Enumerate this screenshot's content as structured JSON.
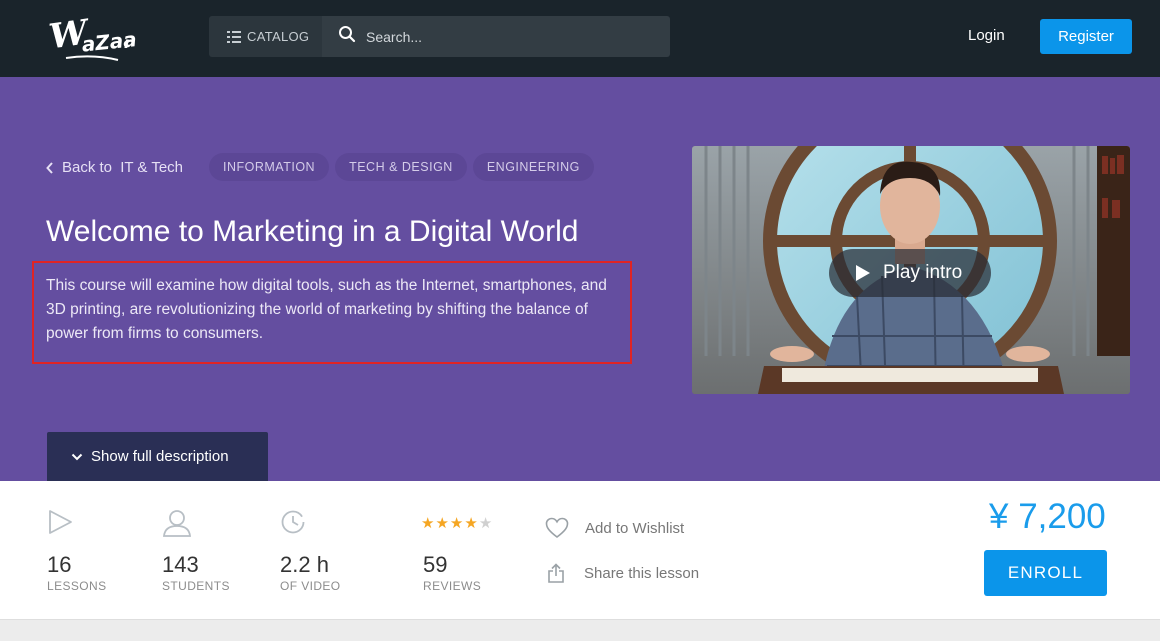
{
  "brand": {
    "logo_text": "WaZaar"
  },
  "nav": {
    "catalog_label": "CATALOG",
    "search_placeholder": "Search...",
    "login_label": "Login",
    "register_label": "Register"
  },
  "hero": {
    "back_prefix": "Back to ",
    "back_category": "IT & Tech",
    "tags": [
      "INFORMATION",
      "TECH & DESIGN",
      "ENGINEERING"
    ],
    "title": "Welcome to Marketing in a Digital World",
    "description": "This course will examine how digital tools, such as the Internet, smartphones, and 3D printing, are revolutionizing the world of marketing by shifting the balance of power from firms to consumers.",
    "show_full_label": "Show full description",
    "play_label": "Play intro"
  },
  "stats": {
    "lessons": {
      "value": "16",
      "label": "LESSONS",
      "icon": "play-outline-icon"
    },
    "students": {
      "value": "143",
      "label": "STUDENTS",
      "icon": "user-outline-icon"
    },
    "video": {
      "value": "2.2 h",
      "label": "OF VIDEO",
      "icon": "clock-icon"
    },
    "reviews": {
      "value": "59",
      "label": "REVIEWS",
      "rating": 4,
      "max_rating": 5
    }
  },
  "actions": {
    "wishlist_label": "Add to Wishlist",
    "share_label": "Share this lesson"
  },
  "purchase": {
    "price": "¥ 7,200",
    "enroll_label": "ENROLL"
  },
  "colors": {
    "topbar": "#1a242b",
    "hero": "#644ea0",
    "accent": "#0b95ea",
    "star_filled": "#f5a623",
    "star_empty": "#d0d0d0",
    "highlight_box": "#e02424"
  }
}
